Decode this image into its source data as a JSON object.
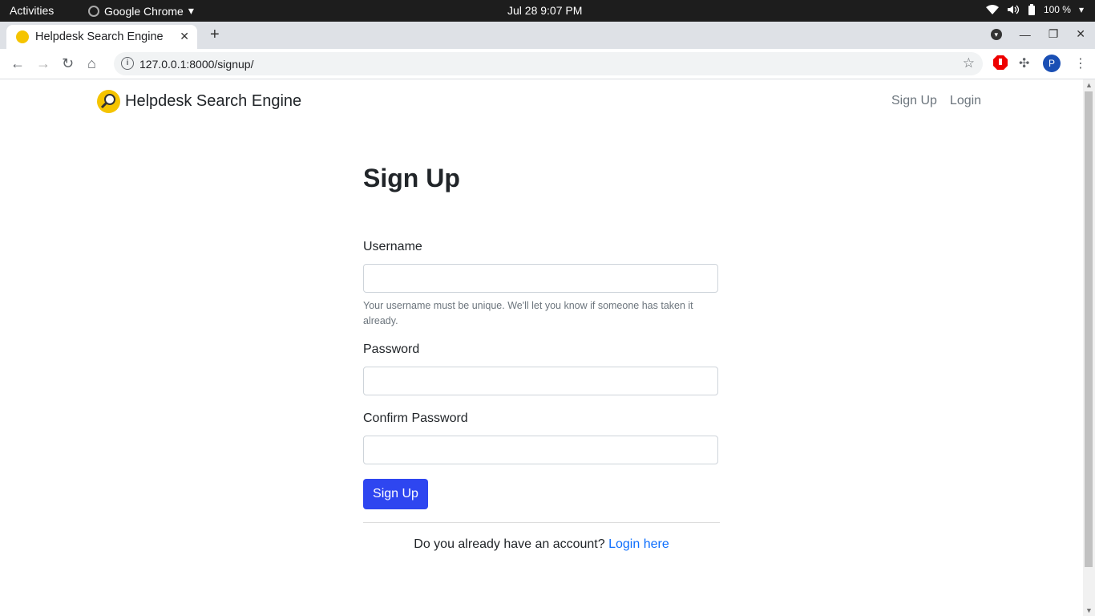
{
  "os": {
    "activities": "Activities",
    "app_name": "Google Chrome",
    "clock": "Jul 28   9:07 PM",
    "battery": "100 %"
  },
  "browser": {
    "tab_title": "Helpdesk Search Engine",
    "url": "127.0.0.1:8000/signup/",
    "profile_initial": "P"
  },
  "site": {
    "brand": "Helpdesk Search Engine",
    "nav": [
      "Sign Up",
      "Login"
    ]
  },
  "form": {
    "title": "Sign Up",
    "username_label": "Username",
    "username_help": "Your username must be unique. We'll let you know if someone has taken it already.",
    "password_label": "Password",
    "confirm_label": "Confirm Password",
    "submit_label": "Sign Up",
    "already_text": "Do you already have an account?",
    "login_link": "Login here"
  },
  "colors": {
    "primary_button": "#2e46f0",
    "link": "#0d6efd",
    "logo_yellow": "#f5c400"
  }
}
